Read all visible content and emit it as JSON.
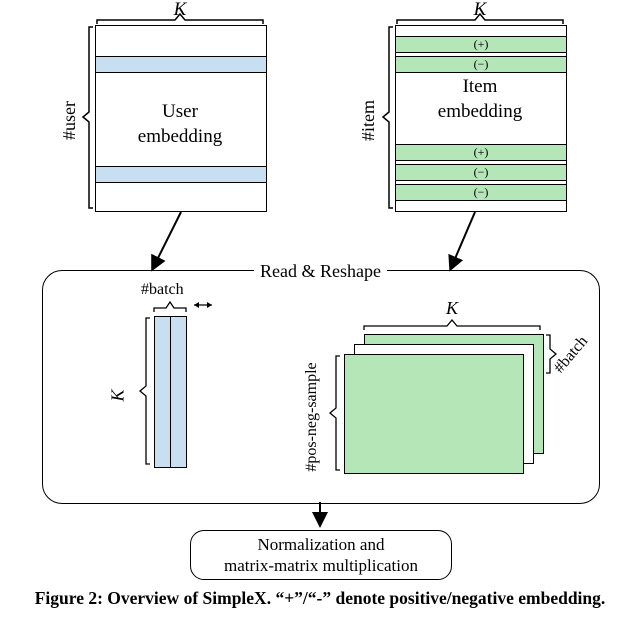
{
  "top": {
    "K_left": "K",
    "K_right": "K",
    "n_user": "#user",
    "n_item": "#item",
    "user_label_l1": "User",
    "user_label_l2": "embedding",
    "item_label_l1": "Item",
    "item_label_l2": "embedding",
    "pm_rows": [
      "(+)",
      "(−)",
      "(+)",
      "(−)",
      "(−)"
    ]
  },
  "middle": {
    "read_reshape": "Read & Reshape",
    "batch_u": "#batch",
    "K_u": "K",
    "K_i": "K",
    "batch_i": "#batch",
    "posneg": "#pos-neg-sample"
  },
  "bottom": {
    "norm_l1": "Normalization and",
    "norm_l2": "matrix-matrix multiplication"
  },
  "caption": "Figure 2: Overview of SimpleX. “+”/“-” denote positive/negative embedding."
}
